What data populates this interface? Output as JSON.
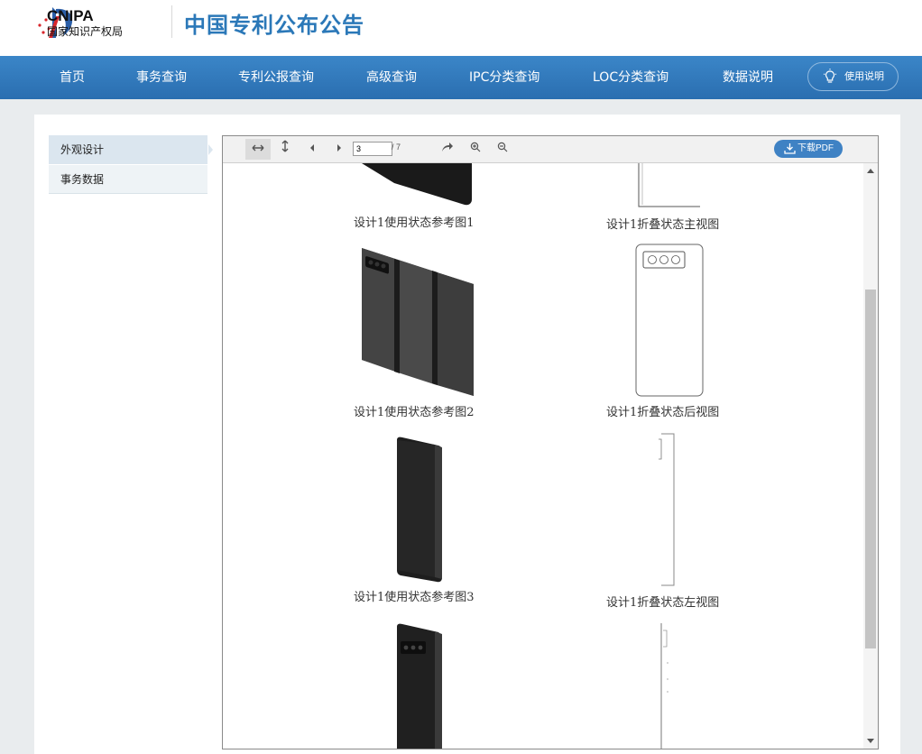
{
  "header": {
    "logo_en": "CNIPA",
    "logo_cn": "国家知识产权局",
    "site_title": "中国专利公布公告"
  },
  "nav": {
    "items": [
      "首页",
      "事务查询",
      "专利公报查询",
      "高级查询",
      "IPC分类查询",
      "LOC分类查询",
      "数据说明"
    ],
    "help_label": "使用说明"
  },
  "sidebar": {
    "items": [
      {
        "label": "外观设计",
        "active": true
      },
      {
        "label": "事务数据",
        "active": false
      }
    ]
  },
  "viewer": {
    "page_current": "3",
    "page_total": "/ 7",
    "download_label": "下载PDF",
    "captions": {
      "use1": "设计1使用状态参考图1",
      "front": "设计1折叠状态主视图",
      "use2": "设计1使用状态参考图2",
      "rear": "设计1折叠状态后视图",
      "use3": "设计1使用状态参考图3",
      "left": "设计1折叠状态左视图"
    }
  },
  "colors": {
    "nav_bg": "#2f77ba",
    "title_blue": "#2b78b8",
    "download_btn": "#3f82c4"
  }
}
